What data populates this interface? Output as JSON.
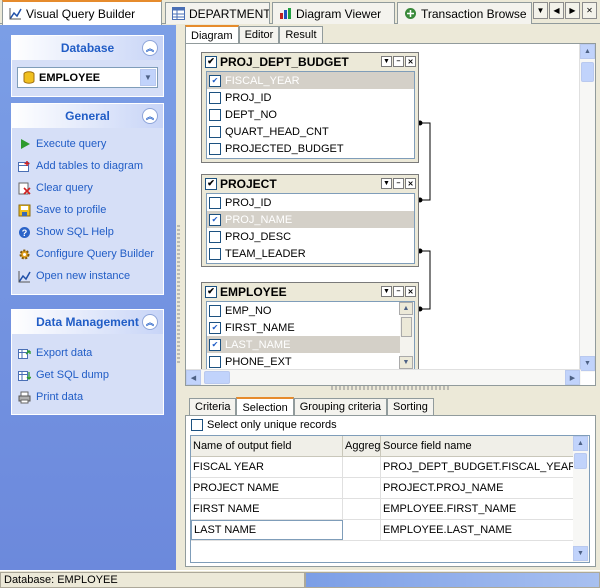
{
  "tabs": [
    {
      "label": "Visual Query Builder",
      "icon": "query-builder-icon",
      "active": true
    },
    {
      "label": "DEPARTMENT",
      "icon": "table-icon"
    },
    {
      "label": "Diagram Viewer",
      "icon": "diagram-viewer-icon"
    },
    {
      "label": "Transaction Browse",
      "icon": "transaction-icon"
    }
  ],
  "sidebar": {
    "database": {
      "title": "Database",
      "selected": "EMPLOYEE"
    },
    "general": {
      "title": "General",
      "items": [
        {
          "label": "Execute query",
          "icon": "play-icon"
        },
        {
          "label": "Add tables to diagram",
          "icon": "add-tables-icon"
        },
        {
          "label": "Clear query",
          "icon": "clear-icon"
        },
        {
          "label": "Save to profile",
          "icon": "save-icon"
        },
        {
          "label": "Show SQL Help",
          "icon": "help-icon"
        },
        {
          "label": "Configure Query Builder",
          "icon": "configure-icon"
        },
        {
          "label": "Open new instance",
          "icon": "new-instance-icon"
        }
      ]
    },
    "data_management": {
      "title": "Data Management",
      "items": [
        {
          "label": "Export data",
          "icon": "export-icon"
        },
        {
          "label": "Get SQL dump",
          "icon": "sql-dump-icon"
        },
        {
          "label": "Print data",
          "icon": "print-icon"
        }
      ]
    }
  },
  "subtabs": [
    "Diagram",
    "Editor",
    "Result"
  ],
  "diagram": {
    "tables": [
      {
        "name": "PROJ_DEPT_BUDGET",
        "fields": [
          {
            "name": "FISCAL_YEAR",
            "checked": true,
            "selected": true
          },
          {
            "name": "PROJ_ID",
            "checked": false
          },
          {
            "name": "DEPT_NO",
            "checked": false
          },
          {
            "name": "QUART_HEAD_CNT",
            "checked": false
          },
          {
            "name": "PROJECTED_BUDGET",
            "checked": false
          }
        ]
      },
      {
        "name": "PROJECT",
        "fields": [
          {
            "name": "PROJ_ID",
            "checked": false
          },
          {
            "name": "PROJ_NAME",
            "checked": true,
            "selected": true
          },
          {
            "name": "PROJ_DESC",
            "checked": false
          },
          {
            "name": "TEAM_LEADER",
            "checked": false
          }
        ]
      },
      {
        "name": "EMPLOYEE",
        "fields": [
          {
            "name": "EMP_NO",
            "checked": false
          },
          {
            "name": "FIRST_NAME",
            "checked": true
          },
          {
            "name": "LAST_NAME",
            "checked": true,
            "selected": true
          },
          {
            "name": "PHONE_EXT",
            "checked": false
          }
        ]
      }
    ]
  },
  "criteria_tabs": [
    "Criteria",
    "Selection",
    "Grouping criteria",
    "Sorting"
  ],
  "selection": {
    "unique_label": "Select only unique records",
    "columns": [
      "Name of output field",
      "Aggreg",
      "Source field name"
    ],
    "rows": [
      {
        "output": "FISCAL YEAR",
        "aggregate": "",
        "source": "PROJ_DEPT_BUDGET.FISCAL_YEAR"
      },
      {
        "output": "PROJECT NAME",
        "aggregate": "",
        "source": "PROJECT.PROJ_NAME"
      },
      {
        "output": "FIRST NAME",
        "aggregate": "",
        "source": "EMPLOYEE.FIRST_NAME"
      },
      {
        "output": "LAST NAME",
        "aggregate": "",
        "source": "EMPLOYEE.LAST_NAME"
      }
    ]
  },
  "status": {
    "database": "Database: EMPLOYEE"
  },
  "colors": {
    "accent": "#e68b2c",
    "sidebar": "#6c89dc",
    "link": "#215dc6"
  }
}
